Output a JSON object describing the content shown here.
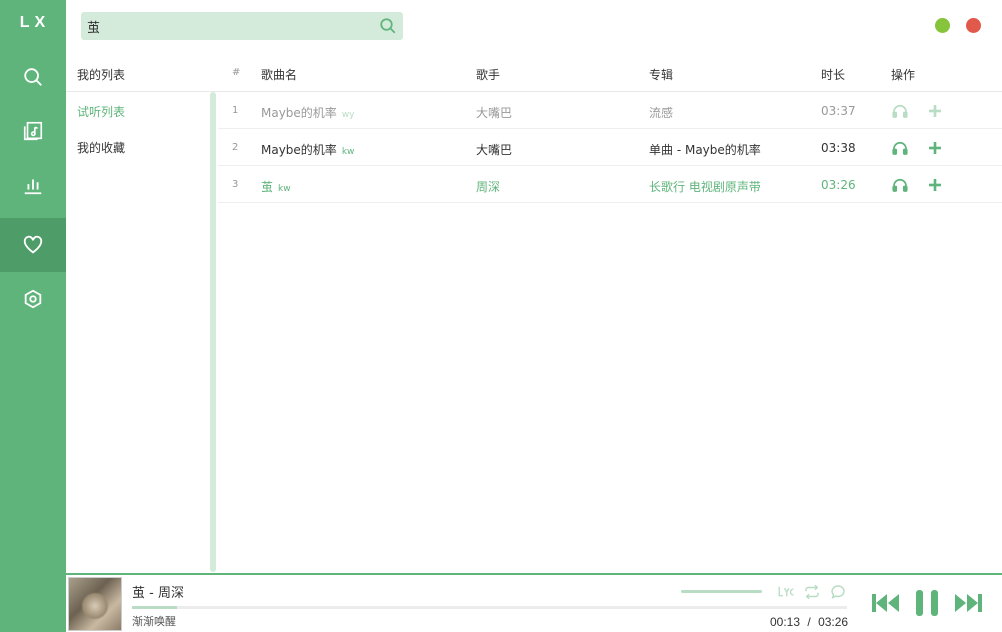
{
  "app": {
    "logo": "LX"
  },
  "colors": {
    "accent": "#5fb47b",
    "accent_dark": "#4e9d68",
    "accent_light": "#d4ebdb",
    "minimize": "#85c43b",
    "close": "#e0594a"
  },
  "sidebar": {
    "items": [
      {
        "icon": "search-icon"
      },
      {
        "icon": "music-library-icon"
      },
      {
        "icon": "chart-icon"
      },
      {
        "icon": "heart-icon",
        "active": true
      },
      {
        "icon": "settings-icon"
      }
    ]
  },
  "search": {
    "value": "茧",
    "placeholder": ""
  },
  "lists": {
    "header": "我的列表",
    "items": [
      {
        "label": "试听列表",
        "active": true
      },
      {
        "label": "我的收藏",
        "active": false
      }
    ]
  },
  "table": {
    "headers": {
      "index": "#",
      "name": "歌曲名",
      "singer": "歌手",
      "album": "专辑",
      "duration": "时长",
      "actions": "操作"
    },
    "rows": [
      {
        "index": "1",
        "name": "Maybe的机率",
        "source": "wy",
        "singer": "大嘴巴",
        "album": "流感",
        "duration": "03:37",
        "state": "dim"
      },
      {
        "index": "2",
        "name": "Maybe的机率",
        "source": "kw",
        "singer": "大嘴巴",
        "album": "单曲 - Maybe的机率",
        "duration": "03:38",
        "state": "normal"
      },
      {
        "index": "3",
        "name": "茧",
        "source": "kw",
        "singer": "周深",
        "album": "长歌行 电视剧原声带",
        "duration": "03:26",
        "state": "active"
      }
    ]
  },
  "player": {
    "title": "茧 - 周深",
    "lyric": "渐渐唤醒",
    "current_time": "00:13",
    "separator": "/",
    "total_time": "03:26",
    "progress": 0.063,
    "volume": 1.0
  }
}
